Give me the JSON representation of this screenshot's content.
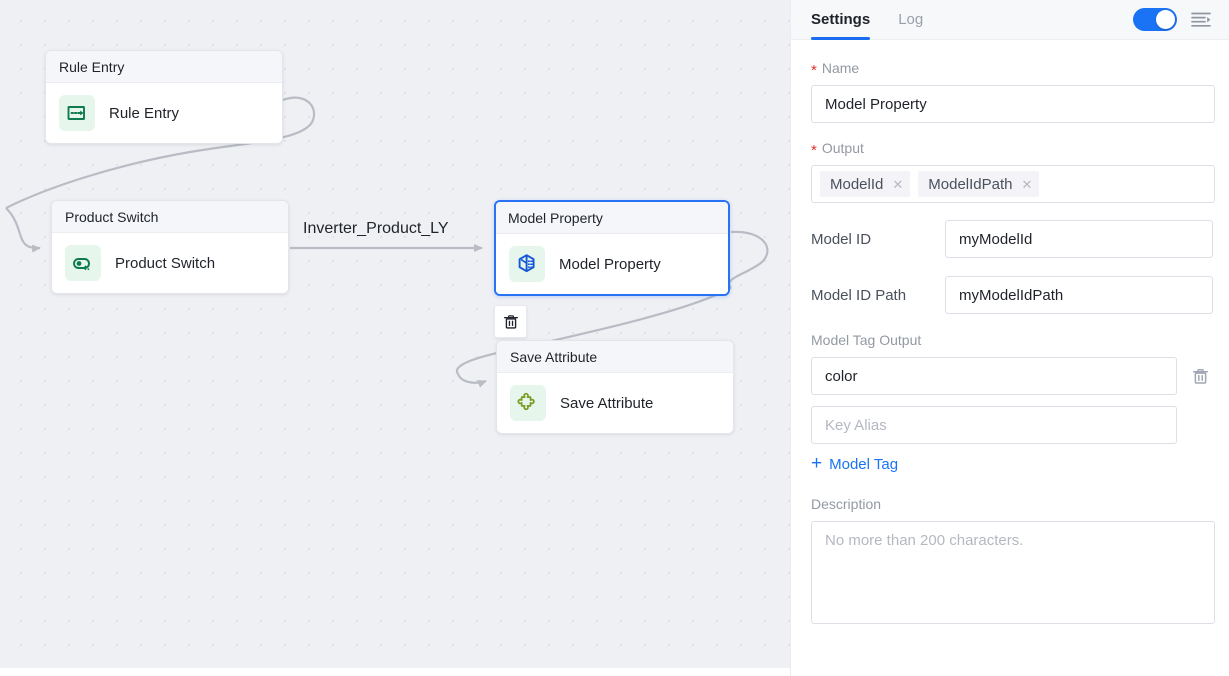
{
  "canvas": {
    "edge_label": "Inverter_Product_LY",
    "delete_button_icon": "trash-icon",
    "nodes": [
      {
        "id": "rule-entry",
        "title": "Rule Entry",
        "label": "Rule Entry",
        "icon": "rule-entry-icon",
        "icon_color": "#0f7a4f",
        "selected": false
      },
      {
        "id": "product-switch",
        "title": "Product Switch",
        "label": "Product Switch",
        "icon": "product-switch-icon",
        "icon_color": "#0f7a4f",
        "selected": false
      },
      {
        "id": "model-property",
        "title": "Model Property",
        "label": "Model Property",
        "icon": "model-property-icon",
        "icon_color": "#1558d6",
        "selected": true
      },
      {
        "id": "save-attribute",
        "title": "Save Attribute",
        "label": "Save Attribute",
        "icon": "puzzle-piece-icon",
        "icon_color": "#7a9a20",
        "selected": false
      }
    ]
  },
  "panel": {
    "tabs": [
      {
        "key": "settings",
        "label": "Settings",
        "active": true
      },
      {
        "key": "log",
        "label": "Log",
        "active": false
      }
    ],
    "toggle": {
      "state": "on",
      "color": "#1a73f5"
    },
    "collapse_icon": "collapse-panel-icon",
    "name": {
      "label": "Name",
      "required": true,
      "value": "Model Property"
    },
    "output": {
      "label": "Output",
      "required": true,
      "chips": [
        {
          "text": "ModelId",
          "remove_icon": "close-icon"
        },
        {
          "text": "ModelIdPath",
          "remove_icon": "close-icon"
        }
      ]
    },
    "model_id": {
      "label": "Model ID",
      "value": "myModelId"
    },
    "model_id_path": {
      "label": "Model ID Path",
      "value": "myModelIdPath"
    },
    "model_tag_output": {
      "label": "Model Tag Output",
      "key_value": "color",
      "alias_placeholder": "Key Alias",
      "alias_value": "",
      "delete_icon": "trash-icon",
      "add_label": "Model Tag",
      "add_icon": "plus-icon"
    },
    "description": {
      "label": "Description",
      "placeholder": "No more than 200 characters.",
      "value": ""
    }
  }
}
